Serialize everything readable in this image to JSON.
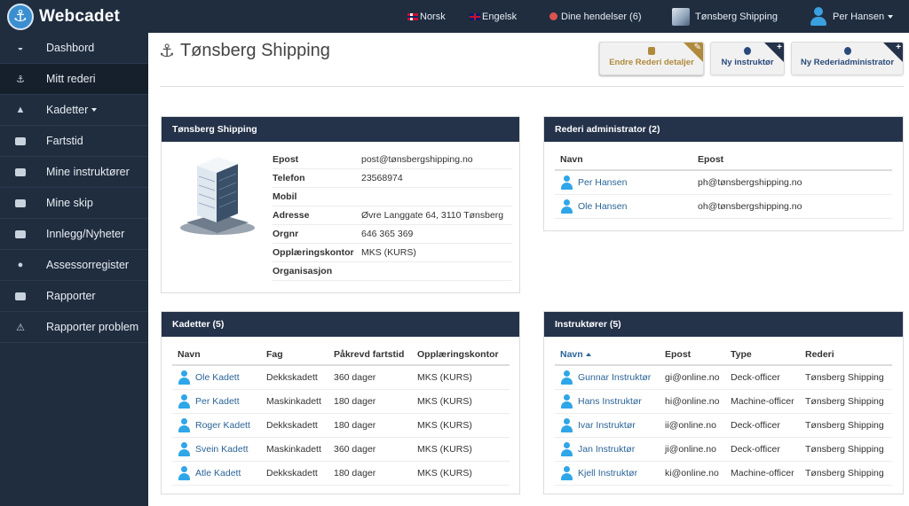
{
  "brand": {
    "name": "Webcadet",
    "logo_icon": "anchor-icon"
  },
  "topnav": {
    "lang_no": "Norsk",
    "lang_en": "Engelsk",
    "events": "Dine hendelser (6)",
    "company": "Tønsberg Shipping",
    "user": "Per Hansen"
  },
  "sidebar": {
    "items": [
      {
        "label": "Dashbord",
        "icon": "dashboard-icon"
      },
      {
        "label": "Mitt rederi",
        "icon": "anchor-icon"
      },
      {
        "label": "Kadetter",
        "icon": "graduation-cap-icon"
      },
      {
        "label": "Fartstid",
        "icon": "ship-icon"
      },
      {
        "label": "Mine instruktører",
        "icon": "briefcase-icon"
      },
      {
        "label": "Mine skip",
        "icon": "ship-icon"
      },
      {
        "label": "Innlegg/Nyheter",
        "icon": "newspaper-icon"
      },
      {
        "label": "Assessorregister",
        "icon": "user-icon"
      },
      {
        "label": "Rapporter",
        "icon": "book-icon"
      },
      {
        "label": "Rapporter problem",
        "icon": "warning-icon"
      }
    ]
  },
  "page": {
    "title": "Tønsberg Shipping",
    "buttons": {
      "edit": "Endre Rederi detaljer",
      "new_instructor": "Ny instruktør",
      "new_admin": "Ny Rederiadministrator"
    }
  },
  "company_panel": {
    "title": "Tønsberg Shipping",
    "rows": [
      {
        "key": "Epost",
        "value": "post@tønsbergshipping.no"
      },
      {
        "key": "Telefon",
        "value": "23568974"
      },
      {
        "key": "Mobil",
        "value": ""
      },
      {
        "key": "Adresse",
        "value": "Øvre Langgate 64, 3110 Tønsberg"
      },
      {
        "key": "Orgnr",
        "value": "646 365 369"
      },
      {
        "key": "Opplæringskontor",
        "value": "MKS (KURS)"
      },
      {
        "key": "Organisasjon",
        "value": ""
      }
    ]
  },
  "admin_panel": {
    "title": "Rederi administrator (2)",
    "headers": [
      "Navn",
      "Epost"
    ],
    "rows": [
      {
        "name": "Per Hansen",
        "email": "ph@tønsbergshipping.no"
      },
      {
        "name": "Ole Hansen",
        "email": "oh@tønsbergshipping.no"
      }
    ]
  },
  "cadets_panel": {
    "title": "Kadetter (5)",
    "headers": [
      "Navn",
      "Fag",
      "Påkrevd fartstid",
      "Opplæringskontor"
    ],
    "rows": [
      {
        "name": "Ole Kadett",
        "fag": "Dekkskadett",
        "tid": "360 dager",
        "kontor": "MKS (KURS)"
      },
      {
        "name": "Per Kadett",
        "fag": "Maskinkadett",
        "tid": "180 dager",
        "kontor": "MKS (KURS)"
      },
      {
        "name": "Roger Kadett",
        "fag": "Dekkskadett",
        "tid": "180 dager",
        "kontor": "MKS (KURS)"
      },
      {
        "name": "Svein Kadett",
        "fag": "Maskinkadett",
        "tid": "360 dager",
        "kontor": "MKS (KURS)"
      },
      {
        "name": "Atle Kadett",
        "fag": "Dekkskadett",
        "tid": "180 dager",
        "kontor": "MKS (KURS)"
      }
    ]
  },
  "instructors_panel": {
    "title": "Instruktører (5)",
    "headers": [
      "Navn",
      "Epost",
      "Type",
      "Rederi"
    ],
    "rows": [
      {
        "name": "Gunnar Instruktør",
        "email": "gi@online.no",
        "type": "Deck-officer",
        "rederi": "Tønsberg Shipping"
      },
      {
        "name": "Hans Instruktør",
        "email": "hi@online.no",
        "type": "Machine-officer",
        "rederi": "Tønsberg Shipping"
      },
      {
        "name": "Ivar Instruktør",
        "email": "ii@online.no",
        "type": "Deck-officer",
        "rederi": "Tønsberg Shipping"
      },
      {
        "name": "Jan Instruktør",
        "email": "ji@online.no",
        "type": "Deck-officer",
        "rederi": "Tønsberg Shipping"
      },
      {
        "name": "Kjell Instruktør",
        "email": "ki@online.no",
        "type": "Machine-officer",
        "rederi": "Tønsberg Shipping"
      }
    ]
  },
  "colors": {
    "nav_bg": "#1f2d3f",
    "panel_head": "#24324a",
    "link": "#2a6496",
    "person_icon": "#2fa6e8",
    "edit_accent": "#b08a3c"
  }
}
